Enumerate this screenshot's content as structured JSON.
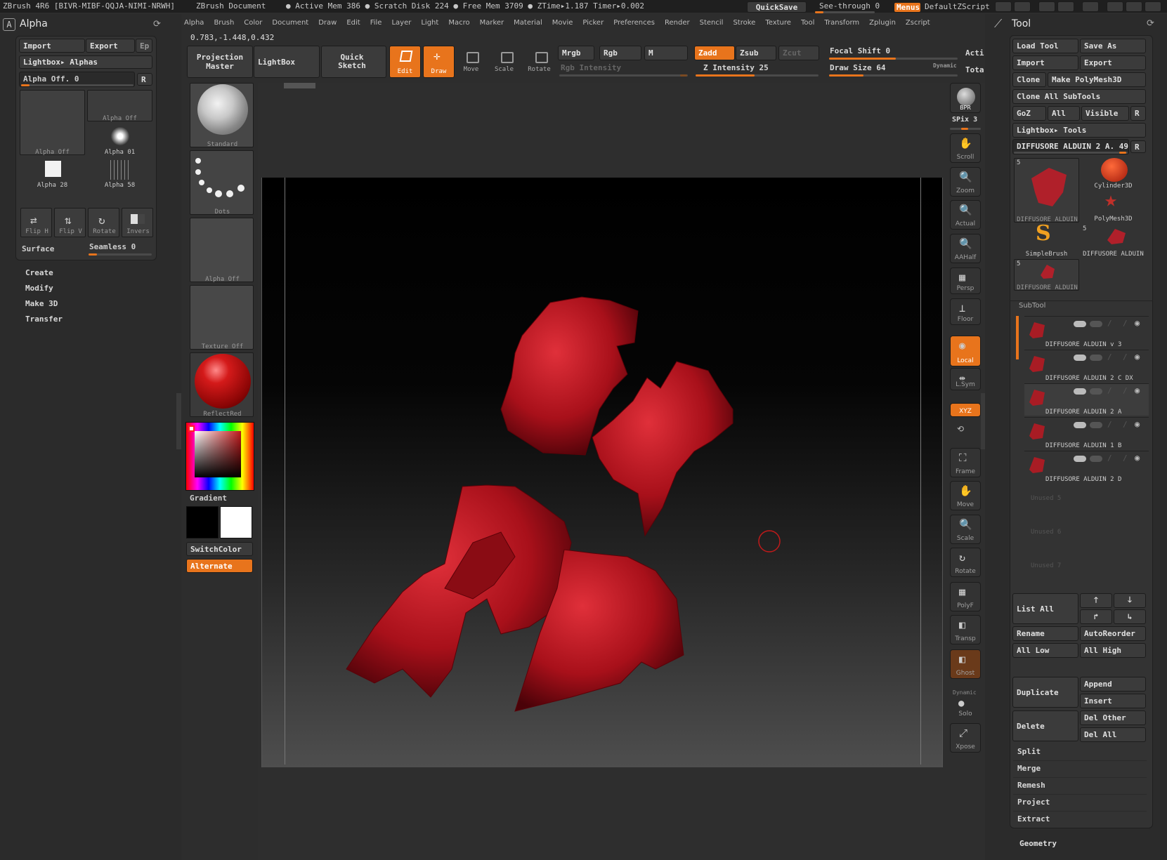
{
  "titlebar": {
    "app": "ZBrush 4R6 [BIVR-MIBF-QQJA-NIMI-NRWH]",
    "doc": "ZBrush Document",
    "mem": "● Active Mem 386 ● Scratch Disk 224 ● Free Mem 3709 ● ZTime▸1.187 Timer▸0.002",
    "quicksave": "QuickSave",
    "seethrough": "See-through   0",
    "menus": "Menus",
    "script": "DefaultZScript"
  },
  "menubar": [
    "Alpha",
    "Brush",
    "Color",
    "Document",
    "Draw",
    "Edit",
    "File",
    "Layer",
    "Light",
    "Macro",
    "Marker",
    "Material",
    "Movie",
    "Picker",
    "Preferences",
    "Render",
    "Stencil",
    "Stroke",
    "Texture",
    "Tool",
    "Transform",
    "Zplugin",
    "Zscript"
  ],
  "coords": "0.783,-1.448,0.432",
  "left": {
    "title": "Alpha",
    "import": "Import",
    "export": "Export",
    "ep": "Ep",
    "lightbox": "Lightbox▸ Alphas",
    "alpha_off": "Alpha Off. 0",
    "r": "R",
    "thumbs": [
      "Alpha Off",
      "Alpha Off",
      "Alpha 01",
      "Alpha 28",
      "Alpha 58"
    ],
    "tools": [
      "Flip H",
      "Flip V",
      "Rotate",
      "Invers"
    ],
    "surface": "Surface",
    "seamless": "Seamless 0",
    "menu": [
      "Create",
      "Modify",
      "Make 3D",
      "Transfer"
    ]
  },
  "shelf": {
    "projection": "Projection Master",
    "lightbox": "LightBox",
    "quick": "Quick Sketch",
    "edit": "Edit",
    "draw": "Draw",
    "move": "Move",
    "scale": "Scale",
    "rotate": "Rotate",
    "mrgb": "Mrgb",
    "rgb": "Rgb",
    "m": "M",
    "rgb_int": "Rgb Intensity",
    "zadd": "Zadd",
    "zsub": "Zsub",
    "zcut": "Zcut",
    "zint": "Z Intensity 25",
    "focal": "Focal Shift 0",
    "drawsize": "Draw Size 64",
    "dynamic": "Dynamic",
    "acti": "Acti",
    "tota": "Tota"
  },
  "palette": {
    "standard": "Standard",
    "dots": "Dots",
    "alpha_off": "Alpha Off",
    "texture_off": "Texture Off",
    "material": "ReflectRed",
    "gradient": "Gradient",
    "switch": "SwitchColor",
    "alternate": "Alternate"
  },
  "rightbar": {
    "bpr": "BPR",
    "spix": "SPix 3",
    "items": [
      "Scroll",
      "Zoom",
      "Actual",
      "AAHalf",
      "Persp",
      "Floor",
      "Local",
      "L.Sym",
      "XYZ",
      "Frame",
      "Move",
      "Scale",
      "Rotate",
      "PolyF",
      "Transp",
      "Ghost",
      "Dynamic",
      "Solo",
      "Xpose"
    ]
  },
  "tool": {
    "title": "Tool",
    "load": "Load Tool",
    "saveas": "Save As",
    "import": "Import",
    "export": "Export",
    "clone": "Clone",
    "make": "Make PolyMesh3D",
    "cloneall": "Clone All SubTools",
    "goz": "GoZ",
    "all": "All",
    "visible": "Visible",
    "r": "R",
    "lightbox": "Lightbox▸ Tools",
    "current": "DIFFUSORE ALDUIN 2 A. 49",
    "thumbs": [
      "DIFFUSORE ALDUIN",
      "Cylinder3D",
      "PolyMesh3D",
      "SimpleBrush",
      "DIFFUSORE ALDUIN",
      "DIFFUSORE ALDUIN"
    ],
    "counts": [
      "5",
      "5",
      "5"
    ],
    "subtool": "SubTool",
    "subtools": [
      "DIFFUSORE ALDUIN v 3",
      "DIFFUSORE ALDUIN 2 C DX",
      "DIFFUSORE ALDUIN 2 A",
      "DIFFUSORE ALDUIN 1 B",
      "DIFFUSORE ALDUIN 2 D"
    ],
    "unused": [
      "Unused 5",
      "Unused 6",
      "Unused 7"
    ],
    "listall": "List All",
    "rename": "Rename",
    "autoreorder": "AutoReorder",
    "alllow": "All Low",
    "allhigh": "All High",
    "duplicate": "Duplicate",
    "append": "Append",
    "insert": "Insert",
    "delete": "Delete",
    "delother": "Del Other",
    "delall": "Del All",
    "split": "Split",
    "merge": "Merge",
    "remesh": "Remesh",
    "project": "Project",
    "extract": "Extract",
    "geometry": "Geometry"
  }
}
